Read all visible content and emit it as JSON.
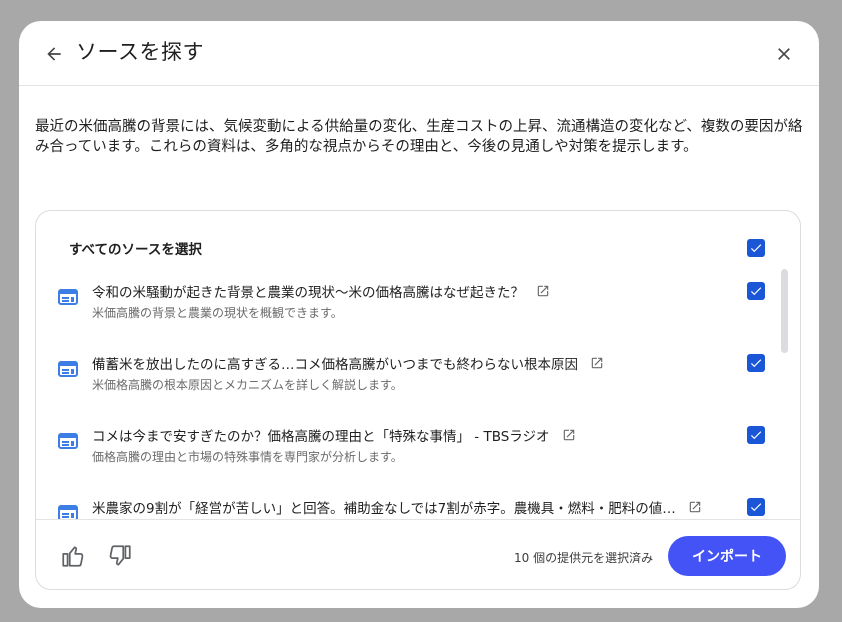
{
  "dialog": {
    "title": "ソースを探す",
    "back_icon": "arrow-left-icon",
    "close_icon": "close-icon"
  },
  "summary": "最近の米価高騰の背景には、気候変動による供給量の変化、生産コストの上昇、流通構造の変化など、複数の要因が絡み合っています。これらの資料は、多角的な視点からその理由と、今後の見通しや対策を提示します。",
  "select_all": {
    "label": "すべてのソースを選択",
    "checked": true
  },
  "sources": [
    {
      "title": "令和の米騒動が起きた背景と農業の現状〜米の価格高騰はなぜ起きた？",
      "description": "米価高騰の背景と農業の現状を概観できます。",
      "checked": true
    },
    {
      "title": "備蓄米を放出したのに高すぎる…コメ価格高騰がいつまでも終わらない根本原因",
      "description": "米価格高騰の根本原因とメカニズムを詳しく解説します。",
      "checked": true
    },
    {
      "title": "コメは今まで安すぎたのか？価格高騰の理由と「特殊な事情」 - TBSラジオ",
      "description": "価格高騰の理由と市場の特殊事情を専門家が分析します。",
      "checked": true
    },
    {
      "title": "米農家の9割が「経営が苦しい」と回答。補助金なしでは7割が赤字。農機具・燃料・肥料の値…",
      "description": "",
      "checked": true
    }
  ],
  "footer": {
    "selected_count": "10 個の提供元を選択済み",
    "import_label": "インポート",
    "thumb_up_icon": "thumbs-up-icon",
    "thumb_down_icon": "thumbs-down-icon"
  },
  "colors": {
    "accent": "#4453f5",
    "checkbox": "#1a56d6",
    "source_icon": "#3d7de6"
  }
}
